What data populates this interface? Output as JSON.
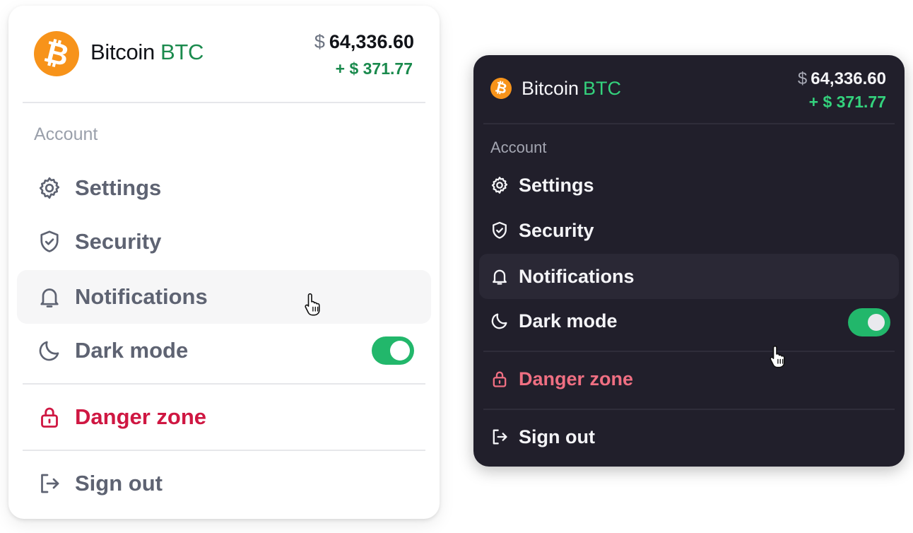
{
  "colors": {
    "bitcoin_orange": "#f7931a",
    "positive_green": "#1a8a4d",
    "toggle_green": "#22b76b",
    "danger_red": "#cf1742",
    "dark_background": "#211f2b"
  },
  "light": {
    "coin": {
      "icon": "bitcoin-icon",
      "logo_glyph": "₿",
      "name": "Bitcoin",
      "ticker": "BTC",
      "currency_symbol": "$",
      "price": "64,336.60",
      "change": "+ $ 371.77"
    },
    "section_label": "Account",
    "menu": [
      {
        "label": "Settings",
        "icon": "gear-icon"
      },
      {
        "label": "Security",
        "icon": "shield-check-icon"
      },
      {
        "label": "Notifications",
        "icon": "bell-icon",
        "state": "hovered"
      },
      {
        "label": "Dark mode",
        "icon": "moon-icon",
        "toggle": true
      }
    ],
    "danger": {
      "label": "Danger zone",
      "icon": "lock-icon"
    },
    "signout": {
      "label": "Sign out",
      "icon": "sign-out-icon"
    }
  },
  "dark": {
    "coin": {
      "icon": "bitcoin-icon",
      "logo_glyph": "₿",
      "name": "Bitcoin",
      "ticker": "BTC",
      "currency_symbol": "$",
      "price": "64,336.60",
      "change": "+ $ 371.77"
    },
    "section_label": "Account",
    "menu": [
      {
        "label": "Settings",
        "icon": "gear-icon"
      },
      {
        "label": "Security",
        "icon": "shield-check-icon"
      },
      {
        "label": "Notifications",
        "icon": "bell-icon",
        "state": "hovered"
      },
      {
        "label": "Dark mode",
        "icon": "moon-icon",
        "toggle": true
      }
    ],
    "danger": {
      "label": "Danger zone",
      "icon": "lock-icon"
    },
    "signout": {
      "label": "Sign out",
      "icon": "sign-out-icon"
    }
  }
}
